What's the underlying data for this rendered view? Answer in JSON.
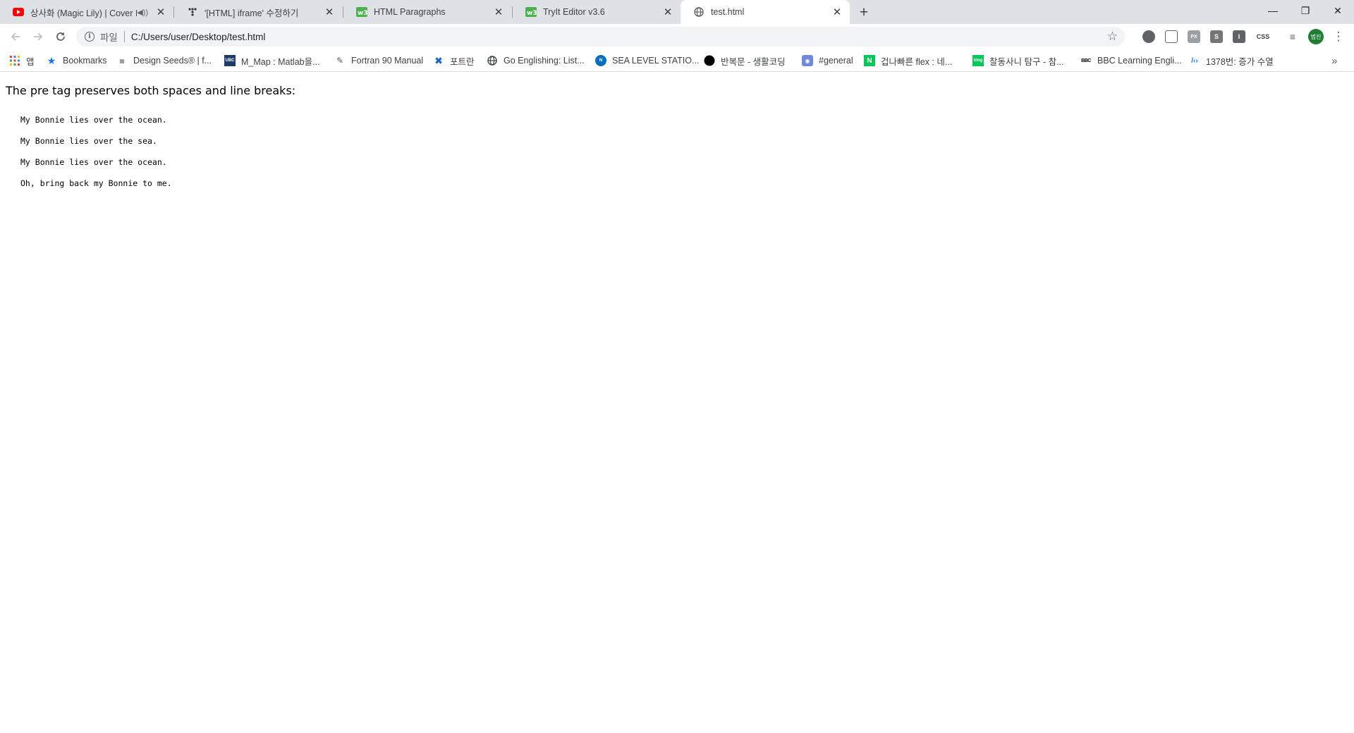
{
  "browser": {
    "tabs": [
      {
        "title": "상사화 (Magic Lily) | Cover I",
        "icon": "youtube-icon",
        "has_mute": true
      },
      {
        "title": "'[HTML] iframe' 수정하기",
        "icon": "velog-icon"
      },
      {
        "title": "HTML Paragraphs",
        "icon": "w3schools-icon"
      },
      {
        "title": "TryIt Editor v3.6",
        "icon": "w3schools-icon"
      },
      {
        "title": "test.html",
        "icon": "globe-icon",
        "active": true
      }
    ],
    "address_bar": {
      "scheme_label": "파일",
      "url": "C:/Users/user/Desktop/test.html"
    },
    "avatar_text": "범진",
    "extension_labels": [
      "",
      "",
      "PX",
      "S",
      "I",
      "CSS"
    ],
    "bookmarks": [
      {
        "label": "앱",
        "icon": "apps-grid-icon"
      },
      {
        "label": "Bookmarks",
        "icon": "star-icon"
      },
      {
        "label": "Design Seeds® | f...",
        "icon": "designseeds-icon"
      },
      {
        "label": "M_Map : Matlab을...",
        "icon": "ubc-icon"
      },
      {
        "label": "Fortran 90 Manual",
        "icon": "fortran-icon"
      },
      {
        "label": "포트란",
        "icon": "cross-icon"
      },
      {
        "label": "Go Englishing: List...",
        "icon": "globe-icon"
      },
      {
        "label": "SEA LEVEL STATIO...",
        "icon": "noaa-icon"
      },
      {
        "label": "반복문 - 생활코딩",
        "icon": "black-circle-icon"
      },
      {
        "label": "#general",
        "icon": "discord-icon"
      },
      {
        "label": "겁나빠른 flex : 네...",
        "icon": "naver-icon"
      },
      {
        "label": "찰동사니 탐구 - 참...",
        "icon": "blog-icon"
      },
      {
        "label": "BBC Learning Engli...",
        "icon": "bbc-icon"
      },
      {
        "label": "1378번: 증가 수열",
        "icon": "code-brackets-icon"
      }
    ],
    "colors": {
      "tabstrip_bg": "#dee1e6",
      "omnibox_bg": "#f1f3f4",
      "avatar_bg": "#1e7e34"
    }
  },
  "page": {
    "paragraph": "The pre tag preserves both spaces and line breaks:",
    "pre_lines": [
      "My Bonnie lies over the ocean.",
      "My Bonnie lies over the sea.",
      "My Bonnie lies over the ocean.",
      "Oh, bring back my Bonnie to me."
    ]
  }
}
